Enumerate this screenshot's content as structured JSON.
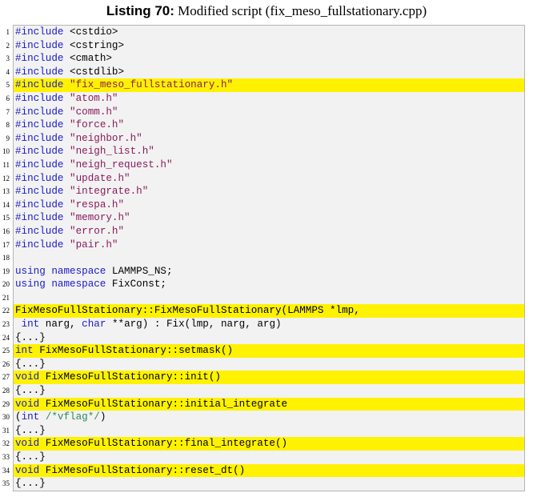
{
  "caption": {
    "label": "Listing 70:",
    "text": " Modified script (fix_meso_fullstationary.cpp)"
  },
  "lines": [
    {
      "n": "1",
      "hl": false,
      "tokens": [
        {
          "t": "kw",
          "v": "#include"
        },
        {
          "t": "plain",
          "v": " <cstdio>"
        }
      ]
    },
    {
      "n": "2",
      "hl": false,
      "tokens": [
        {
          "t": "kw",
          "v": "#include"
        },
        {
          "t": "plain",
          "v": " <cstring>"
        }
      ]
    },
    {
      "n": "3",
      "hl": false,
      "tokens": [
        {
          "t": "kw",
          "v": "#include"
        },
        {
          "t": "plain",
          "v": " <cmath>"
        }
      ]
    },
    {
      "n": "4",
      "hl": false,
      "tokens": [
        {
          "t": "kw",
          "v": "#include"
        },
        {
          "t": "plain",
          "v": " <cstdlib>"
        }
      ]
    },
    {
      "n": "5",
      "hl": true,
      "tokens": [
        {
          "t": "kw",
          "v": "#include"
        },
        {
          "t": "plain",
          "v": " "
        },
        {
          "t": "str",
          "v": "\"fix_meso_fullstationary.h\""
        }
      ]
    },
    {
      "n": "6",
      "hl": false,
      "tokens": [
        {
          "t": "kw",
          "v": "#include"
        },
        {
          "t": "plain",
          "v": " "
        },
        {
          "t": "str",
          "v": "\"atom.h\""
        }
      ]
    },
    {
      "n": "7",
      "hl": false,
      "tokens": [
        {
          "t": "kw",
          "v": "#include"
        },
        {
          "t": "plain",
          "v": " "
        },
        {
          "t": "str",
          "v": "\"comm.h\""
        }
      ]
    },
    {
      "n": "8",
      "hl": false,
      "tokens": [
        {
          "t": "kw",
          "v": "#include"
        },
        {
          "t": "plain",
          "v": " "
        },
        {
          "t": "str",
          "v": "\"force.h\""
        }
      ]
    },
    {
      "n": "9",
      "hl": false,
      "tokens": [
        {
          "t": "kw",
          "v": "#include"
        },
        {
          "t": "plain",
          "v": " "
        },
        {
          "t": "str",
          "v": "\"neighbor.h\""
        }
      ]
    },
    {
      "n": "10",
      "hl": false,
      "tokens": [
        {
          "t": "kw",
          "v": "#include"
        },
        {
          "t": "plain",
          "v": " "
        },
        {
          "t": "str",
          "v": "\"neigh_list.h\""
        }
      ]
    },
    {
      "n": "11",
      "hl": false,
      "tokens": [
        {
          "t": "kw",
          "v": "#include"
        },
        {
          "t": "plain",
          "v": " "
        },
        {
          "t": "str",
          "v": "\"neigh_request.h\""
        }
      ]
    },
    {
      "n": "12",
      "hl": false,
      "tokens": [
        {
          "t": "kw",
          "v": "#include"
        },
        {
          "t": "plain",
          "v": " "
        },
        {
          "t": "str",
          "v": "\"update.h\""
        }
      ]
    },
    {
      "n": "13",
      "hl": false,
      "tokens": [
        {
          "t": "kw",
          "v": "#include"
        },
        {
          "t": "plain",
          "v": " "
        },
        {
          "t": "str",
          "v": "\"integrate.h\""
        }
      ]
    },
    {
      "n": "14",
      "hl": false,
      "tokens": [
        {
          "t": "kw",
          "v": "#include"
        },
        {
          "t": "plain",
          "v": " "
        },
        {
          "t": "str",
          "v": "\"respa.h\""
        }
      ]
    },
    {
      "n": "15",
      "hl": false,
      "tokens": [
        {
          "t": "kw",
          "v": "#include"
        },
        {
          "t": "plain",
          "v": " "
        },
        {
          "t": "str",
          "v": "\"memory.h\""
        }
      ]
    },
    {
      "n": "16",
      "hl": false,
      "tokens": [
        {
          "t": "kw",
          "v": "#include"
        },
        {
          "t": "plain",
          "v": " "
        },
        {
          "t": "str",
          "v": "\"error.h\""
        }
      ]
    },
    {
      "n": "17",
      "hl": false,
      "tokens": [
        {
          "t": "kw",
          "v": "#include"
        },
        {
          "t": "plain",
          "v": " "
        },
        {
          "t": "str",
          "v": "\"pair.h\""
        }
      ]
    },
    {
      "n": "18",
      "hl": false,
      "tokens": []
    },
    {
      "n": "19",
      "hl": false,
      "tokens": [
        {
          "t": "kw",
          "v": "using namespace"
        },
        {
          "t": "plain",
          "v": " LAMMPS_NS;"
        }
      ]
    },
    {
      "n": "20",
      "hl": false,
      "tokens": [
        {
          "t": "kw",
          "v": "using namespace"
        },
        {
          "t": "plain",
          "v": " FixConst;"
        }
      ]
    },
    {
      "n": "21",
      "hl": false,
      "tokens": []
    },
    {
      "n": "22",
      "hl": true,
      "tokens": [
        {
          "t": "plain",
          "v": "FixMesoFullStationary::FixMesoFullStationary(LAMMPS *lmp,"
        }
      ]
    },
    {
      "n": "23",
      "hl": false,
      "tokens": [
        {
          "t": "plain",
          "v": " "
        },
        {
          "t": "kw",
          "v": "int"
        },
        {
          "t": "plain",
          "v": " narg, "
        },
        {
          "t": "kw",
          "v": "char"
        },
        {
          "t": "plain",
          "v": " **arg) : Fix(lmp, narg, arg)"
        }
      ]
    },
    {
      "n": "24",
      "hl": false,
      "tokens": [
        {
          "t": "plain",
          "v": "{...}"
        }
      ]
    },
    {
      "n": "25",
      "hl": true,
      "tokens": [
        {
          "t": "kw",
          "v": "int"
        },
        {
          "t": "plain",
          "v": " FixMesoFullStationary::setmask()"
        }
      ]
    },
    {
      "n": "26",
      "hl": false,
      "tokens": [
        {
          "t": "plain",
          "v": "{...}"
        }
      ]
    },
    {
      "n": "27",
      "hl": true,
      "tokens": [
        {
          "t": "kw",
          "v": "void"
        },
        {
          "t": "plain",
          "v": " FixMesoFullStationary::init()"
        }
      ]
    },
    {
      "n": "28",
      "hl": false,
      "tokens": [
        {
          "t": "plain",
          "v": "{...}"
        }
      ]
    },
    {
      "n": "29",
      "hl": true,
      "tokens": [
        {
          "t": "kw",
          "v": "void"
        },
        {
          "t": "plain",
          "v": " FixMesoFullStationary::initial_integrate"
        }
      ]
    },
    {
      "n": "30",
      "hl": false,
      "tokens": [
        {
          "t": "plain",
          "v": "("
        },
        {
          "t": "kw",
          "v": "int"
        },
        {
          "t": "plain",
          "v": " "
        },
        {
          "t": "cmt",
          "v": "/*vflag*/"
        },
        {
          "t": "plain",
          "v": ")"
        }
      ]
    },
    {
      "n": "31",
      "hl": false,
      "tokens": [
        {
          "t": "plain",
          "v": "{...}"
        }
      ]
    },
    {
      "n": "32",
      "hl": true,
      "tokens": [
        {
          "t": "kw",
          "v": "void"
        },
        {
          "t": "plain",
          "v": " FixMesoFullStationary::final_integrate()"
        }
      ]
    },
    {
      "n": "33",
      "hl": false,
      "tokens": [
        {
          "t": "plain",
          "v": "{...}"
        }
      ]
    },
    {
      "n": "34",
      "hl": true,
      "tokens": [
        {
          "t": "kw",
          "v": "void"
        },
        {
          "t": "plain",
          "v": " FixMesoFullStationary::reset_dt()"
        }
      ]
    },
    {
      "n": "35",
      "hl": false,
      "tokens": [
        {
          "t": "plain",
          "v": "{...}"
        }
      ]
    }
  ]
}
